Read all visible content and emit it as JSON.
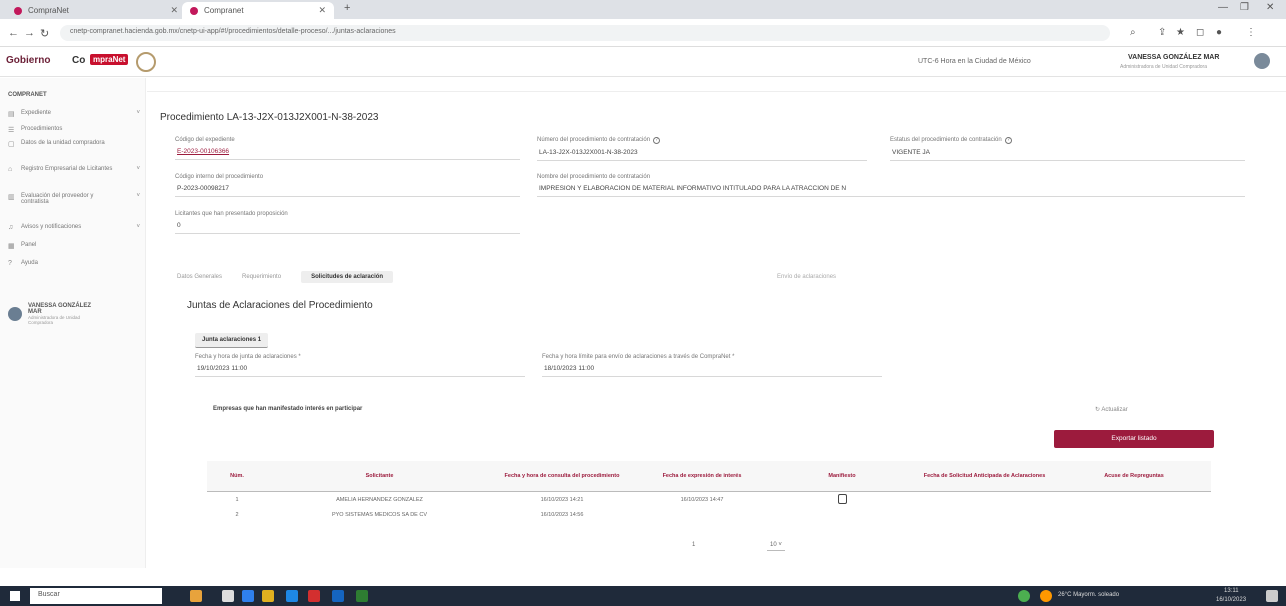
{
  "browser": {
    "tab_inactive": "CompraNet",
    "tab_active": "Compranet",
    "url": "cnetp-compranet.hacienda.gob.mx/cnetp-ui-app/#!/procedimientos/detalle-proceso/.../juntas-aclaraciones",
    "colors": {
      "accent": "#9c1b3d",
      "chrome": "#dee1e6"
    }
  },
  "header": {
    "logo_left": "Gobierno",
    "logo_mid": "Co",
    "logo_badge": "mpraNet",
    "timezone": "UTC-6 Hora en la Ciudad de México",
    "user_name": "VANESSA GONZÁLEZ MAR",
    "user_role": "Administradora de Unidad Compradora"
  },
  "sidebar": {
    "title": "COMPRANET",
    "items": [
      {
        "label": "Expediente",
        "icon": "folder-icon",
        "chevron": "˅"
      },
      {
        "label": "Procedimientos",
        "icon": "list-icon"
      },
      {
        "label": "Datos de la unidad compradora",
        "icon": "document-icon"
      },
      {
        "label": "Registro Empresarial de Licitantes",
        "icon": "building-icon",
        "chevron": "˅"
      },
      {
        "label": "Evaluación del proveedor y contratista",
        "icon": "chart-icon",
        "chevron": "˅"
      },
      {
        "label": "Avisos y notificaciones",
        "icon": "bell-icon",
        "chevron": "˅"
      },
      {
        "label": "Panel",
        "icon": "grid-icon"
      },
      {
        "label": "Ayuda",
        "icon": "help-icon"
      }
    ],
    "user_name": "VANESSA GONZÁLEZ MAR",
    "user_role": "Administradora de Unidad Compradora"
  },
  "procedure": {
    "title": "Procedimiento LA-13-J2X-013J2X001-N-38-2023",
    "fields": {
      "codigo_expediente_label": "Código del expediente",
      "codigo_expediente": "E-2023-00106366",
      "numero_procedimiento_label": "Número del procedimiento de contratación",
      "numero_procedimiento": "LA-13-J2X-013J2X001-N-38-2023",
      "estatus_label": "Estatus del procedimiento de contratación",
      "estatus": "VIGENTE JA",
      "codigo_interno_label": "Código interno del procedimiento",
      "codigo_interno": "P-2023-00098217",
      "nombre_procedimiento_label": "Nombre del procedimiento de contratación",
      "nombre_procedimiento": "IMPRESIÓN Y ELABORACIÓN DE MATERIAL INFORMATIVO INTITULADO PARA LA ATRACCIÓN DE N",
      "licitantes_label": "Licitantes que han presentado proposición",
      "licitantes": "0"
    }
  },
  "tabs": [
    {
      "label": "Datos Generales"
    },
    {
      "label": "Requerimiento"
    },
    {
      "label": "Solicitudes de aclaración",
      "active": true
    }
  ],
  "tab_extra": "Envío de aclaraciones",
  "juntas": {
    "section_title": "Juntas de Aclaraciones del Procedimiento",
    "chip": "Junta aclaraciones 1",
    "fecha_junta_label": "Fecha y hora de junta de aclaraciones *",
    "fecha_junta": "19/10/2023 11:00",
    "fecha_limite_label": "Fecha y hora límite para envío de aclaraciones a través de CompraNet *",
    "fecha_limite": "18/10/2023 11:00"
  },
  "empresas": {
    "title": "Empresas que han manifestado interés en participar",
    "refresh": "↻ Actualizar",
    "export_label": "Exportar listado",
    "columns": [
      "Núm.",
      "Solicitante",
      "Fecha y hora de consulta del procedimiento",
      "Fecha de expresión de interés",
      "Manifiesto",
      "Fecha de Solicitud Anticipada de Aclaraciones",
      "Acuse de Repreguntas"
    ],
    "rows": [
      {
        "num": "1",
        "solicitante": "AMELIA HERNANDEZ GONZALEZ",
        "consulta": "16/10/2023 14:21",
        "interes": "16/10/2023 14:47"
      },
      {
        "num": "2",
        "solicitante": "PYO SISTEMAS MEDICOS SA DE CV",
        "consulta": "16/10/2023 14:56",
        "interes": ""
      }
    ],
    "pager": "1",
    "page_size": "10 ˅"
  },
  "taskbar": {
    "search_placeholder": "Buscar",
    "weather": "26°C  Mayorm. soleado",
    "time": "13:11",
    "date": "16/10/2023"
  }
}
